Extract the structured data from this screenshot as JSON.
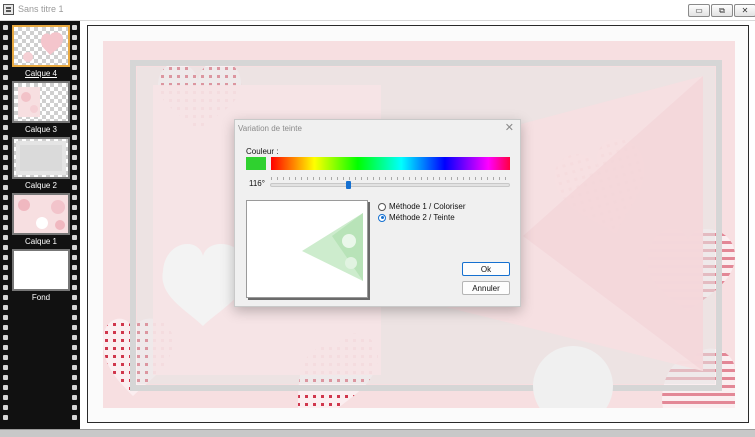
{
  "window": {
    "title": "Sans titre 1",
    "minimize_glyph": "▭",
    "maximize_glyph": "⧉",
    "close_glyph": "✕"
  },
  "layers": [
    {
      "label": "Calque 4",
      "selected": true
    },
    {
      "label": "Calque 3",
      "selected": false
    },
    {
      "label": "Calque 2",
      "selected": false
    },
    {
      "label": "Calque 1",
      "selected": false
    },
    {
      "label": "Fond",
      "selected": false
    }
  ],
  "dialog": {
    "title": "Variation de teinte",
    "color_label": "Couleur :",
    "swatch_color": "#2fd12f",
    "hue_value": "116°",
    "hue_degrees": 116,
    "options": [
      {
        "label": "Méthode 1 / Coloriser",
        "checked": false
      },
      {
        "label": "Méthode 2 / Teinte",
        "checked": true
      }
    ],
    "ok_label": "Ok",
    "cancel_label": "Annuler"
  },
  "colors": {
    "background_pink": "#f7dfe1",
    "accent_blue": "#1570d0",
    "selected_layer_border": "#e8a940"
  }
}
